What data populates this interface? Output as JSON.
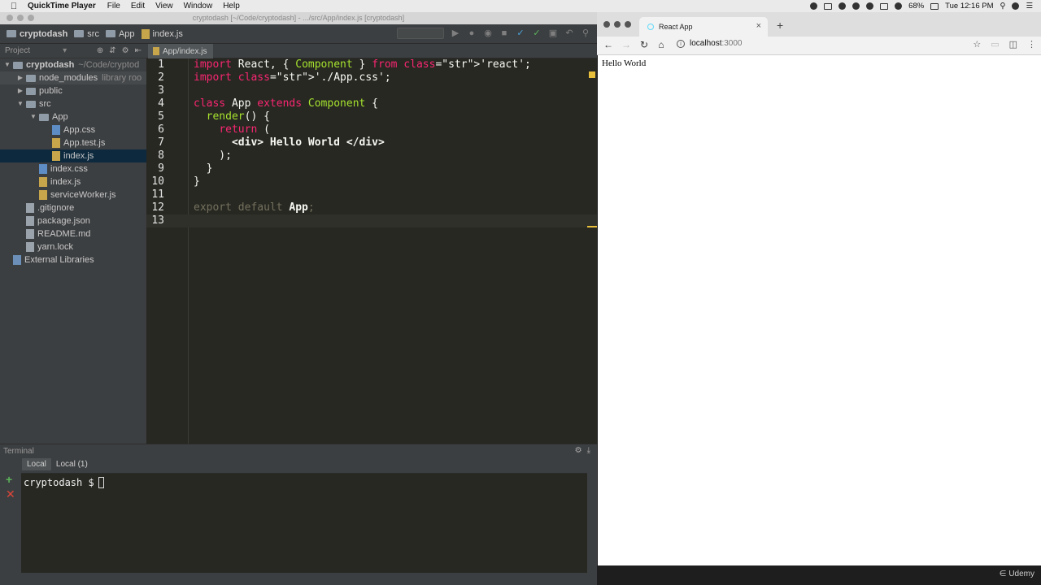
{
  "menubar": {
    "app_name": "QuickTime Player",
    "items": [
      "File",
      "Edit",
      "View",
      "Window",
      "Help"
    ],
    "battery": "68%",
    "clock": "Tue 12:16 PM"
  },
  "ide": {
    "title": "cryptodash [~/Code/cryptodash] - .../src/App/index.js [cryptodash]",
    "breadcrumb": [
      "cryptodash",
      "src",
      "App",
      "index.js"
    ],
    "project_label": "Project",
    "tree": [
      {
        "label": "cryptodash",
        "extra": "~/Code/cryptod",
        "type": "folder",
        "depth": 0,
        "open": true
      },
      {
        "label": "node_modules",
        "extra": "library roo",
        "type": "folder",
        "depth": 1,
        "open": false
      },
      {
        "label": "public",
        "extra": "",
        "type": "folder",
        "depth": 1,
        "open": false
      },
      {
        "label": "src",
        "extra": "",
        "type": "folder",
        "depth": 1,
        "open": true
      },
      {
        "label": "App",
        "extra": "",
        "type": "folder",
        "depth": 2,
        "open": true
      },
      {
        "label": "App.css",
        "extra": "",
        "type": "css",
        "depth": 3
      },
      {
        "label": "App.test.js",
        "extra": "",
        "type": "js",
        "depth": 3
      },
      {
        "label": "index.js",
        "extra": "",
        "type": "js",
        "depth": 3,
        "selected": true
      },
      {
        "label": "index.css",
        "extra": "",
        "type": "css",
        "depth": 2
      },
      {
        "label": "index.js",
        "extra": "",
        "type": "js",
        "depth": 2
      },
      {
        "label": "serviceWorker.js",
        "extra": "",
        "type": "js",
        "depth": 2
      },
      {
        "label": ".gitignore",
        "extra": "",
        "type": "gen",
        "depth": 1
      },
      {
        "label": "package.json",
        "extra": "",
        "type": "gen",
        "depth": 1
      },
      {
        "label": "README.md",
        "extra": "",
        "type": "gen",
        "depth": 1
      },
      {
        "label": "yarn.lock",
        "extra": "",
        "type": "gen",
        "depth": 1
      },
      {
        "label": "External Libraries",
        "extra": "",
        "type": "lib",
        "depth": 0
      }
    ],
    "editor_tab": "App/index.js",
    "code_lines": [
      "import React, { Component } from 'react';",
      "import './App.css';",
      "",
      "class App extends Component {",
      "  render() {",
      "    return (",
      "      <div> Hello World </div>",
      "    );",
      "  }",
      "}",
      "",
      "export default App;",
      ""
    ],
    "line_numbers": [
      "1",
      "2",
      "3",
      "4",
      "5",
      "6",
      "7",
      "8",
      "9",
      "10",
      "11",
      "12",
      "13"
    ],
    "terminal": {
      "header": "Terminal",
      "tabs": [
        "Local",
        "Local (1)"
      ],
      "prompt": "cryptodash $"
    }
  },
  "browser": {
    "tab_title": "React App",
    "url_host": "localhost",
    "url_port": ":3000",
    "page_text": "Hello World",
    "watermark": "Udemy"
  },
  "colors": {
    "editor_bg": "#272822",
    "keyword": "#f92672",
    "class_name": "#a6e22e",
    "string": "#e6db74",
    "panel_bg": "#3c3f41",
    "selection": "#0d293e"
  }
}
